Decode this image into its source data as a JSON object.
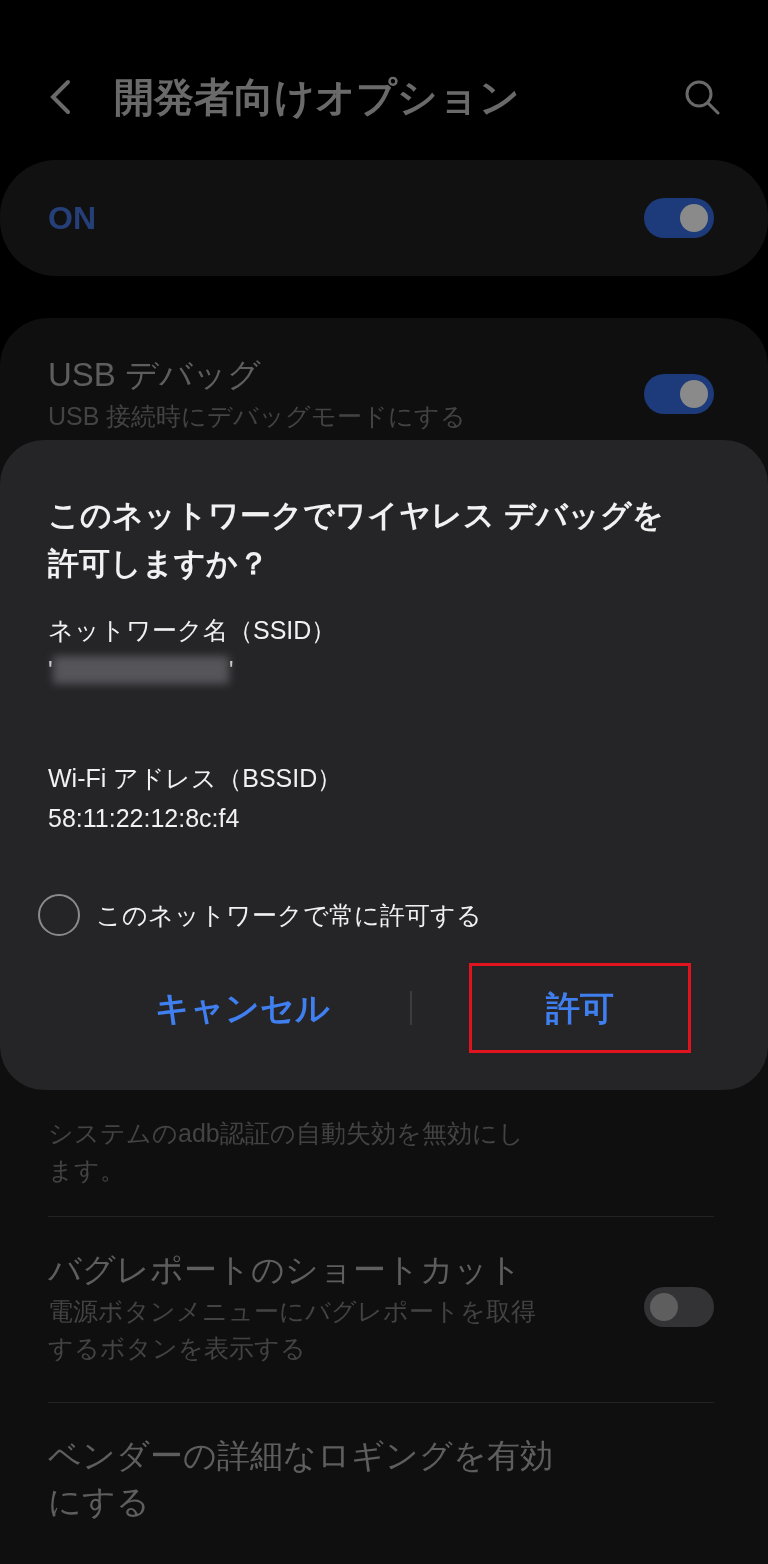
{
  "header": {
    "title": "開発者向けオプション"
  },
  "master_switch": {
    "label": "ON",
    "on": true
  },
  "settings": [
    {
      "title": "USB デバッグ",
      "subtitle": "USB 接続時にデバッグモードにする",
      "on": true
    },
    {
      "subtitle": "システムのadb認証の自動失効を無効にします。"
    },
    {
      "title": "バグレポートのショートカット",
      "subtitle": "電源ボタンメニューにバグレポートを取得するボタンを表示する",
      "on": false
    },
    {
      "title": "ベンダーの詳細なロギングを有効にする"
    }
  ],
  "dialog": {
    "title": "このネットワークでワイヤレス デバッグを許可しますか？",
    "ssid_label": "ネットワーク名（SSID）",
    "ssid_open_quote": "'",
    "ssid_close_quote": "'",
    "bssid_label": "Wi-Fi アドレス（BSSID）",
    "bssid": "58:11:22:12:8c:f4",
    "always_allow": {
      "label": "このネットワークで常に許可する",
      "checked": false
    },
    "buttons": [
      {
        "label": "キャンセル",
        "highlighted": false
      },
      {
        "label": "許可",
        "highlighted": true
      }
    ]
  }
}
